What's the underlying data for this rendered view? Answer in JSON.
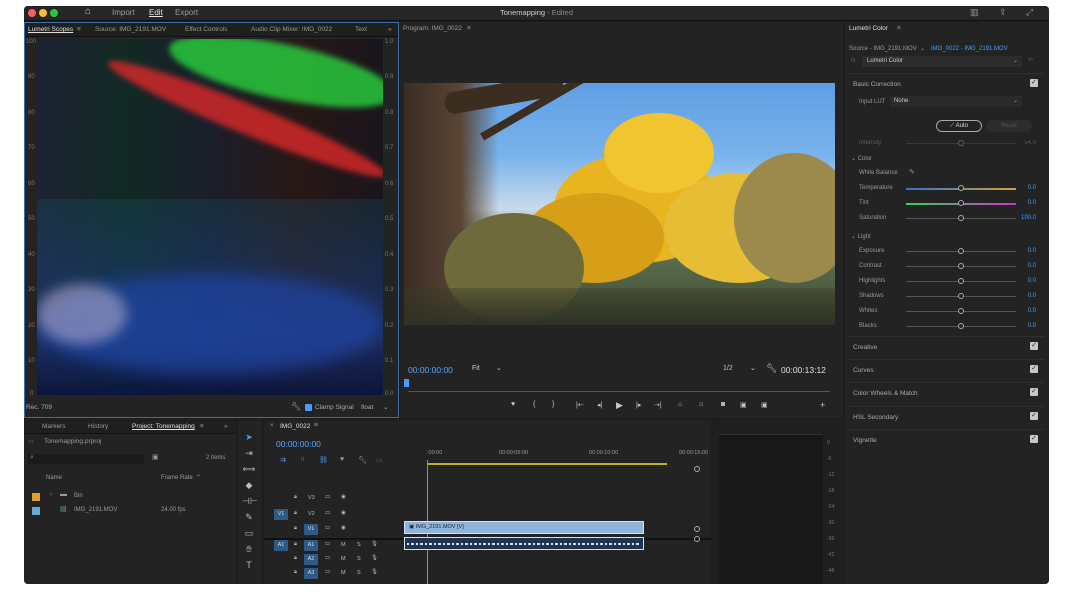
{
  "titlebar": {
    "import": "Import",
    "edit": "Edit",
    "export": "Export",
    "project": "Tonemapping",
    "status": "- Edited"
  },
  "scopes_panel": {
    "tabs": [
      "Lumetri Scopes",
      "Source: IMG_2191.MOV",
      "Effect Controls",
      "Audio Clip Mixer: IMG_0022",
      "Text"
    ],
    "left_scale": [
      "100",
      "90",
      "80",
      "70",
      "60",
      "50",
      "40",
      "30",
      "20",
      "10",
      "0"
    ],
    "right_scale": [
      "1.0",
      "0.9",
      "0.8",
      "0.7",
      "0.6",
      "0.5",
      "0.4",
      "0.3",
      "0.2",
      "0.1",
      "0.0"
    ],
    "colorspace": "Rec. 709",
    "clamp": "Clamp Signal",
    "mode": "float"
  },
  "program": {
    "title": "Program: IMG_0022",
    "timecode": "00:00:00:00",
    "fit": "Fit",
    "resolution": "1/2",
    "duration": "00:00:13:12"
  },
  "lumetri": {
    "title": "Lumetri Color",
    "source": "Source - IMG_2191.MOV",
    "clip": "IMG_0022 - IMG_2191.MOV",
    "effect": "Lumetri Color",
    "basic": "Basic Correction",
    "input_lut_label": "Input LUT",
    "input_lut": "None",
    "auto": "Auto",
    "reset": "Reset",
    "intensity": "Intensity",
    "intensity_val": "54.0",
    "color": "Color",
    "white_balance": "White Balance",
    "color_sliders": [
      {
        "label": "Temperature",
        "value": "0.0"
      },
      {
        "label": "Tint",
        "value": "0.0"
      },
      {
        "label": "Saturation",
        "value": "100.0"
      }
    ],
    "light": "Light",
    "light_sliders": [
      {
        "label": "Exposure",
        "value": "0.0"
      },
      {
        "label": "Contrast",
        "value": "0.0"
      },
      {
        "label": "Highlights",
        "value": "0.0"
      },
      {
        "label": "Shadows",
        "value": "0.0"
      },
      {
        "label": "Whites",
        "value": "0.0"
      },
      {
        "label": "Blacks",
        "value": "0.0"
      }
    ],
    "sections": [
      "Creative",
      "Curves",
      "Color Wheels & Match",
      "HSL Secondary",
      "Vignette"
    ]
  },
  "project_panel": {
    "tabs": [
      "Markers",
      "History",
      "Project: Tonemapping"
    ],
    "file": "Tonemapping.prproj",
    "items": "2 items",
    "col_name": "Name",
    "col_rate": "Frame Rate",
    "rows": [
      {
        "name": "Bin",
        "rate": ""
      },
      {
        "name": "IMG_2191.MOV",
        "rate": "24.00 fps"
      }
    ]
  },
  "timeline": {
    "tab": "IMG_0022",
    "timecode": "00:00:00:00",
    "ruler": [
      ":00:00",
      "00:00:05:00",
      "00:00:10:00",
      "00:00:15:00"
    ],
    "video_tracks": [
      "V3",
      "V2",
      "V1"
    ],
    "audio_tracks": [
      "A1",
      "A2",
      "A3"
    ],
    "clip_label": "IMG_2191.MOV [V]"
  },
  "meter": {
    "scale": [
      "0",
      "-6",
      "-12",
      "-18",
      "-24",
      "-30",
      "-36",
      "-42",
      "-48"
    ]
  }
}
